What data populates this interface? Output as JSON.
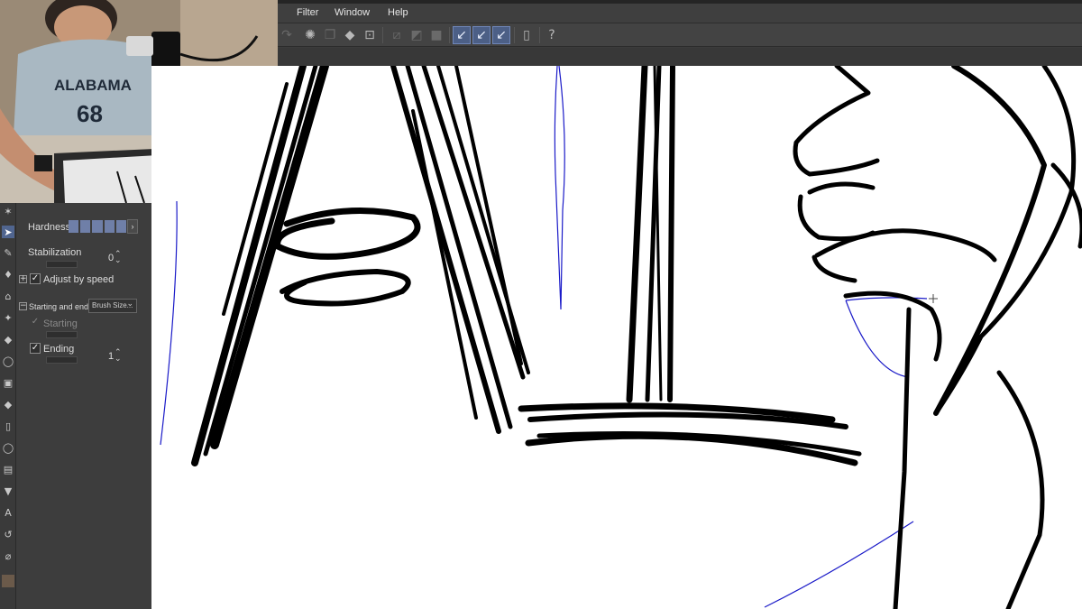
{
  "menu": {
    "items": [
      "Filter",
      "Window",
      "Help"
    ]
  },
  "toolbar": {
    "icons": [
      "redo-icon",
      "loading-icon",
      "copy-icon",
      "fill-icon",
      "transform-icon",
      "clear-icon",
      "gradient-icon",
      "stop-icon",
      "stabilize-icon-1",
      "stabilize-icon-2",
      "stabilize-icon-3",
      "device-icon",
      "help-icon"
    ]
  },
  "tool_properties": {
    "hardness_label": "Hardness",
    "stabilization_label": "Stabilization",
    "stabilization_value": "0",
    "adjust_by_speed_label": "Adjust by speed",
    "starting_and_ending_label": "Starting and ending",
    "starting_and_ending_dropdown": "Brush Size...",
    "starting_label": "Starting",
    "ending_label": "Ending",
    "ending_value": "1"
  },
  "colors": {
    "panel_bg": "#3d3d3d",
    "menubar_bg": "#3f3f3f",
    "accent": "#50658f",
    "canvas_bg": "#ffffff",
    "stroke": "#000000",
    "sketch_line": "#1a1ac8"
  }
}
